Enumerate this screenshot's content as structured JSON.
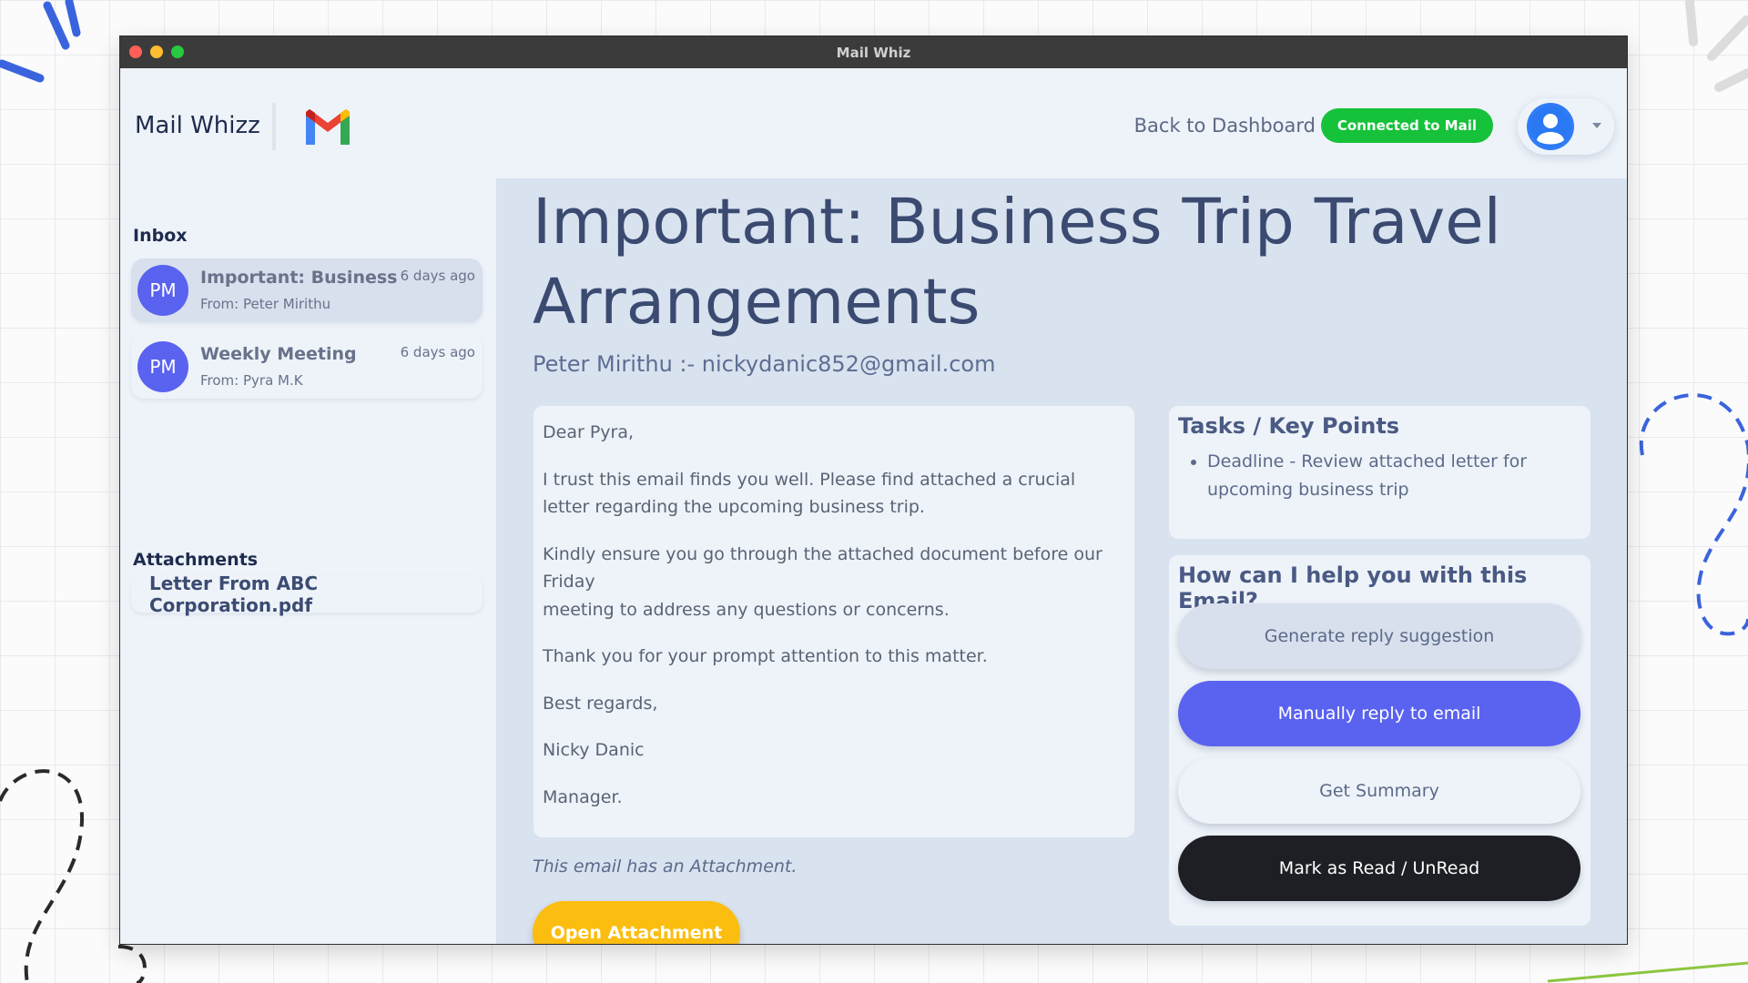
{
  "window": {
    "title": "Mail Whiz"
  },
  "header": {
    "brand": "Mail Whizz",
    "back_link": "Back to Dashboard",
    "status": "Connected to Mail"
  },
  "sidebar": {
    "inbox_title": "Inbox",
    "emails": [
      {
        "initials": "PM",
        "subject": "Important: Business ...",
        "from": "From: Peter Mirithu",
        "time": "6 days ago"
      },
      {
        "initials": "PM",
        "subject": "Weekly Meeting",
        "from": "From: Pyra M.K",
        "time": "6 days ago"
      }
    ],
    "attachments_title": "Attachments",
    "attachment": "Letter From ABC Corporation.pdf"
  },
  "email": {
    "title": "Important: Business Trip Travel Arrangements",
    "sender": "Peter Mirithu :- nickydanic852@gmail.com",
    "greeting": "Dear Pyra,",
    "para1": "I trust this email finds you well. Please find attached a crucial letter regarding the upcoming business trip.",
    "para2_line1": "Kindly ensure you go through the attached document before our Friday",
    "para2_line2": "meeting to address any questions or concerns.",
    "para3": "Thank you for your prompt attention to this matter.",
    "closing": "Best regards,",
    "signature_name": "Nicky Danic",
    "signature_title": "Manager.",
    "attachment_note": "This email has an Attachment.",
    "open_attachment": "Open Attachment"
  },
  "tasks": {
    "title": "Tasks / Key Points",
    "items": [
      "Deadline - Review attached letter for upcoming business trip"
    ]
  },
  "help": {
    "title": "How can I help you with this Email?",
    "suggest": "Generate reply suggestion",
    "manual": "Manually reply to email",
    "summary": "Get Summary",
    "mark": "Mark as Read / UnRead"
  },
  "colors": {
    "accent": "#5a62f0",
    "status_green": "#15c23a",
    "attachment_button": "#fbbd10",
    "dark_button": "#1d1f24"
  },
  "icons": {
    "brand_logo": "gmail-logo",
    "avatar": "user-avatar-icon",
    "menu": "chevron-down-icon"
  }
}
